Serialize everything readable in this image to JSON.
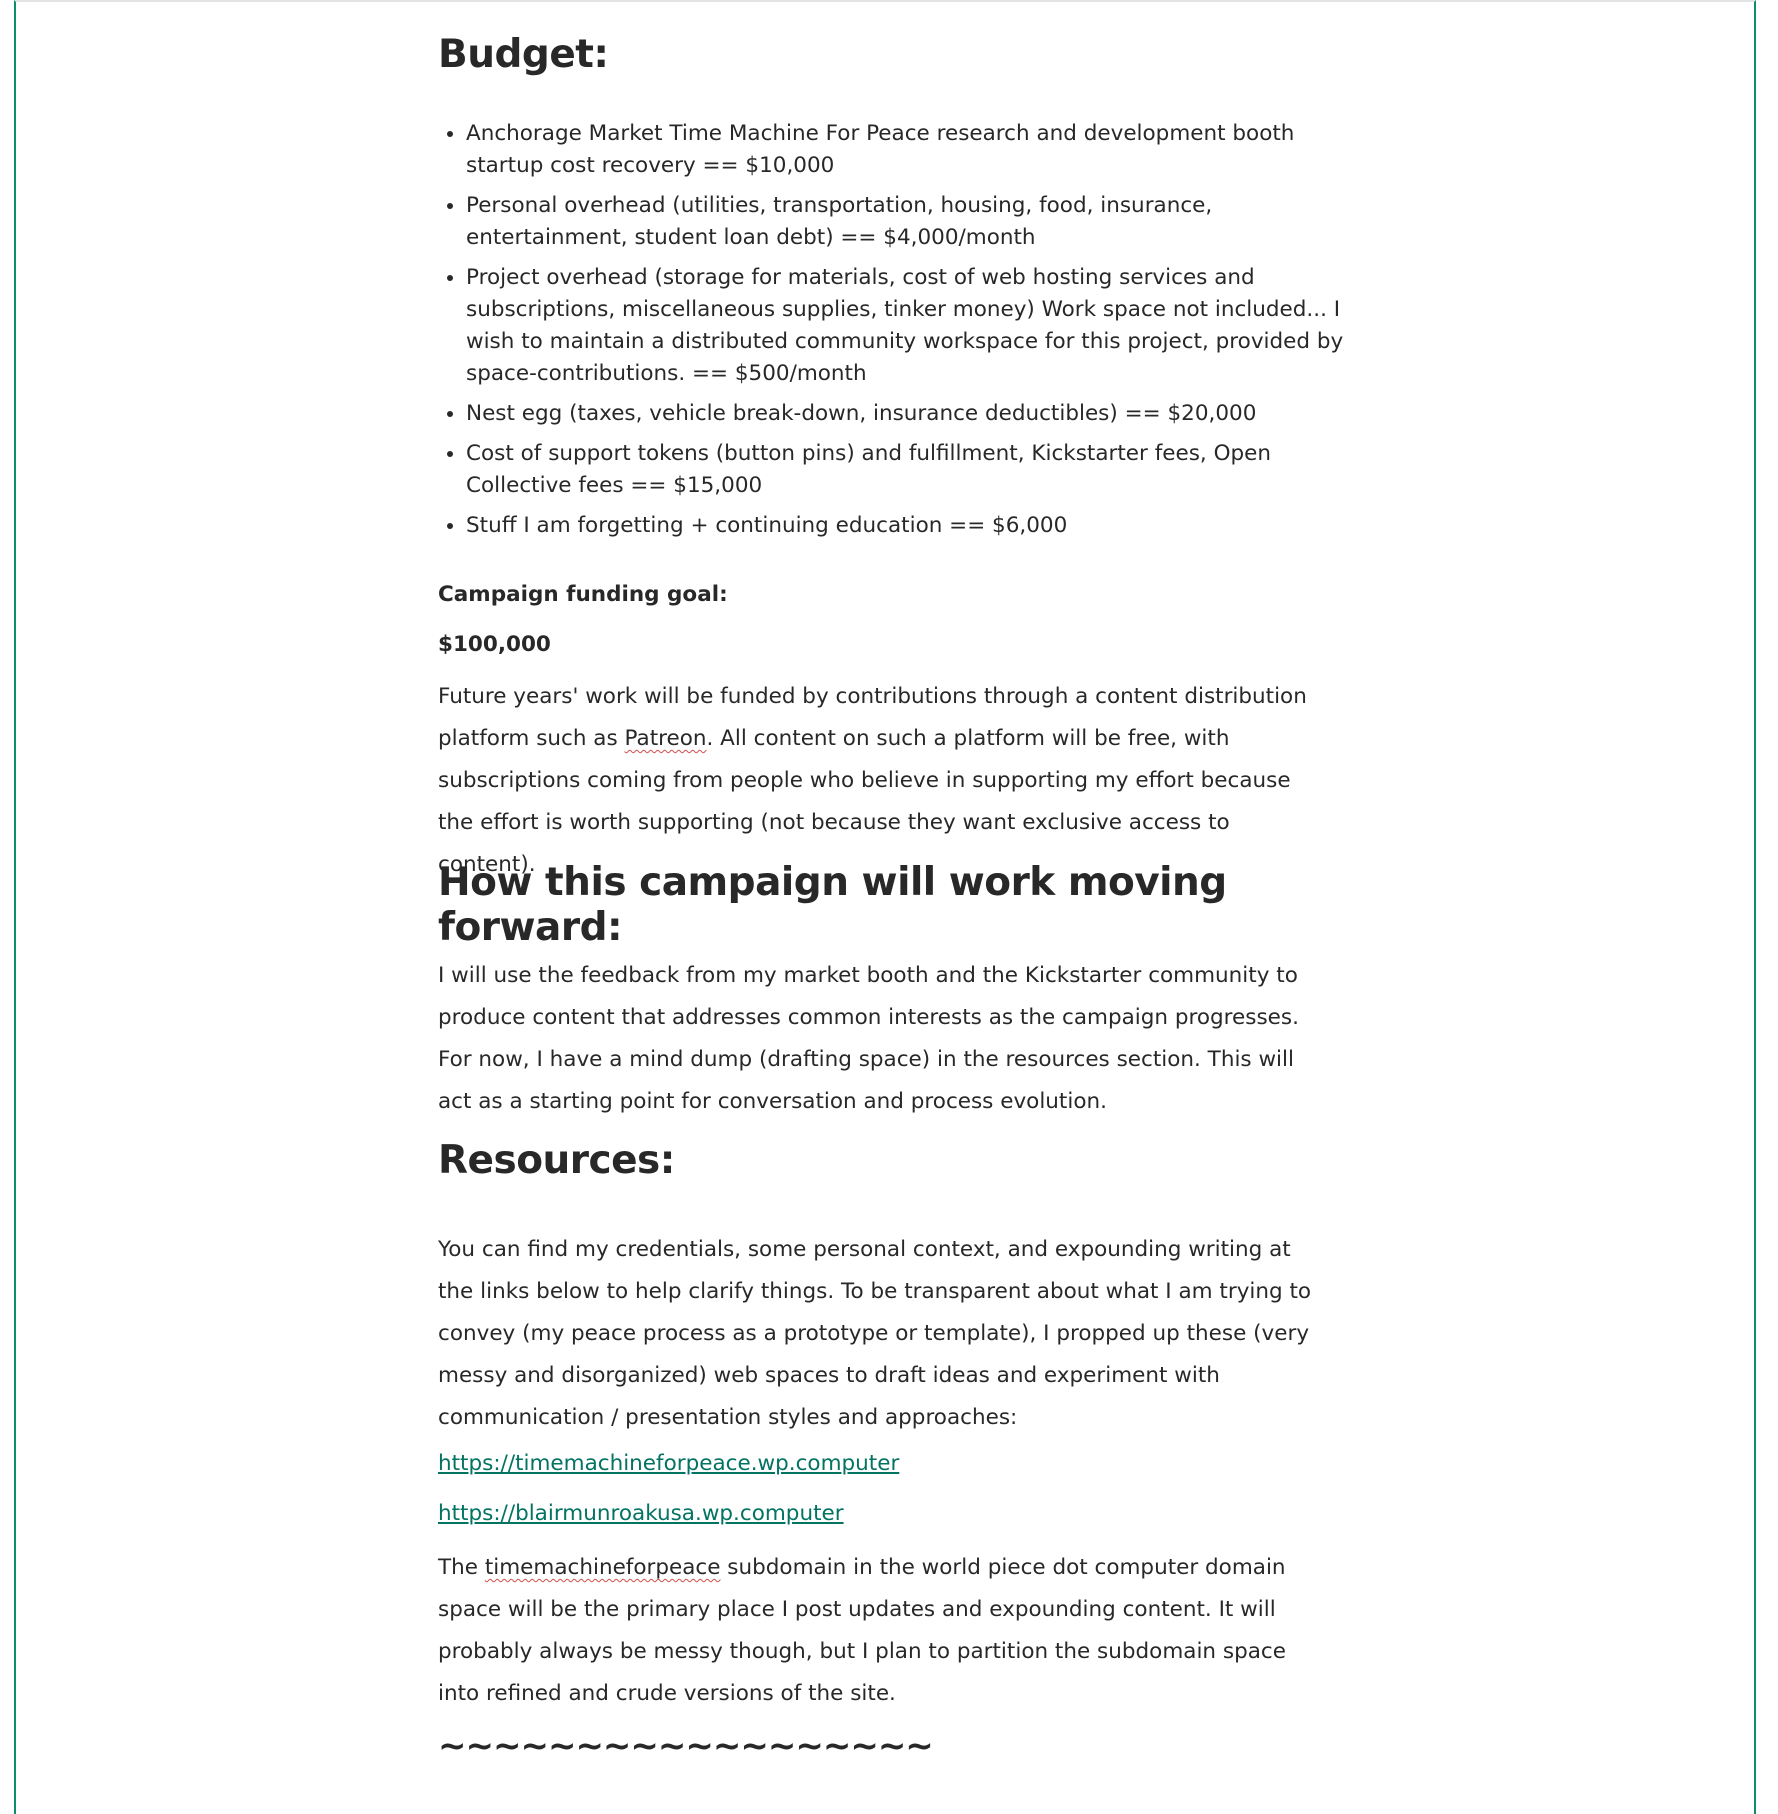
{
  "headings": {
    "budget": "Budget:",
    "how": "How this campaign will work moving forward:",
    "resources": "Resources:"
  },
  "budget_items": [
    "Anchorage Market Time Machine For Peace research and development booth startup cost recovery == $10,000",
    "Personal overhead (utilities, transportation, housing, food, insurance, entertainment, student loan debt) == $4,000/month",
    "Project overhead (storage for materials, cost of web hosting services and subscriptions, miscellaneous supplies, tinker money) Work space not included... I wish to maintain a distributed community workspace for this project, provided by space-contributions. == $500/month",
    "Nest egg (taxes, vehicle break-down, insurance deductibles) == $20,000",
    "Cost of support tokens (button pins) and fulfillment, Kickstarter fees, Open Collective fees == $15,000",
    "Stuff I am forgetting + continuing education == $6,000"
  ],
  "goal": {
    "label": "Campaign funding goal:",
    "value": "$100,000"
  },
  "future": {
    "part1": "Future years' work will be funded by contributions through a content distribution platform such as ",
    "spell": "Patreon",
    "part2": ". All content on such a platform will be free, with subscriptions coming from people who believe in supporting my effort because the effort is worth supporting (not because they want exclusive access to content)."
  },
  "how_text": "I will use the feedback from my market booth and the Kickstarter community to produce content that addresses common interests as the campaign progresses. For now, I have a mind dump (drafting space) in the resources section. This will act as a starting point for conversation and process evolution.",
  "resources_text": "You can find my credentials, some personal context, and expounding writing at the links below to help clarify things. To be transparent about what I am trying to convey (my peace process as a prototype or template), I propped up these (very messy and disorganized) web spaces to draft ideas and experiment with communication / presentation styles and approaches:",
  "links": [
    "https://timemachineforpeace.wp.computer",
    "https://blairmunroakusa.wp.computer"
  ],
  "tm": {
    "part1": "The ",
    "spell": "timemachineforpeace",
    "part2": " subdomain in the world piece dot computer domain space will be the primary place I post updates and expounding content. It will probably always be messy though, but I plan to partition the subdomain space into refined and crude versions of the site."
  },
  "divider": "~~~~~~~~~~~~~~~~~~",
  "colors": {
    "accent": "#0b8f6a",
    "link": "#037362",
    "text": "#282828"
  }
}
